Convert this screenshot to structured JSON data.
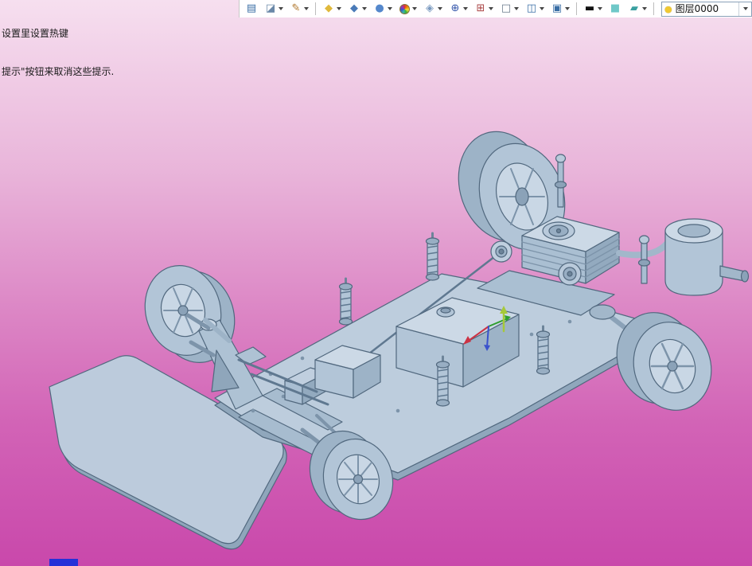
{
  "viewport": {
    "gradient": [
      "#f6dfef",
      "#e9b5da",
      "#dc86c5",
      "#d263b6",
      "#c948ab"
    ]
  },
  "colors": {
    "model_fill": "#b2c5d7",
    "model_stroke": "#51687e",
    "toolbar_bg": "#ffffff",
    "status_fragment": "#2431d8",
    "layer_bulb": "#f0c832"
  },
  "overlay": {
    "line1": "设置里设置热键",
    "line2": "提示\"按钮来取消这些提示."
  },
  "toolbar": {
    "icons": [
      {
        "name": "export-sheet-icon",
        "glyph": "▤",
        "color": "#3a6ea5",
        "dropdown": false
      },
      {
        "name": "render-style-icon",
        "glyph": "◪",
        "color": "#6a88a8",
        "dropdown": true
      },
      {
        "name": "brush-icon",
        "glyph": "✎",
        "color": "#b0762a",
        "dropdown": true
      },
      {
        "name": "separator",
        "sep": true
      },
      {
        "name": "yellow-cube-icon",
        "glyph": "◆",
        "color": "#e0b93c",
        "dropdown": true
      },
      {
        "name": "blue-cube-icon",
        "glyph": "◆",
        "color": "#4a7ab8",
        "dropdown": true
      },
      {
        "name": "sphere-render-icon",
        "glyph": "●",
        "color": "#5588cc",
        "dropdown": true
      },
      {
        "name": "color-wheel-icon",
        "glyph": "",
        "color": "#cc8833",
        "type": "conic",
        "dropdown": true
      },
      {
        "name": "shaded-cube-icon",
        "glyph": "◈",
        "color": "#7a9ac0",
        "dropdown": true
      },
      {
        "name": "target-icon",
        "glyph": "⊕",
        "color": "#3355aa",
        "dropdown": true
      },
      {
        "name": "move-icon",
        "glyph": "⊞",
        "color": "#aa4444",
        "dropdown": true
      },
      {
        "name": "plane-icon",
        "glyph": "□",
        "color": "#667788",
        "dropdown": true
      },
      {
        "name": "window-icon",
        "glyph": "◫",
        "color": "#3a6ea5",
        "dropdown": true
      },
      {
        "name": "display-icon",
        "glyph": "▣",
        "color": "#3a6ea5",
        "dropdown": true
      },
      {
        "name": "separator",
        "sep": true
      },
      {
        "name": "line-width-icon",
        "glyph": "▬",
        "color": "#111111",
        "dropdown": true
      },
      {
        "name": "cyan-swatch-icon",
        "glyph": "■",
        "color": "#6fc8c8",
        "dropdown": false
      },
      {
        "name": "hatch-icon",
        "glyph": "▰",
        "color": "#3aa0a0",
        "dropdown": true
      },
      {
        "name": "separator",
        "sep": true
      }
    ],
    "layer_combo": {
      "bulb_icon": "●",
      "value": "图层0000"
    }
  }
}
